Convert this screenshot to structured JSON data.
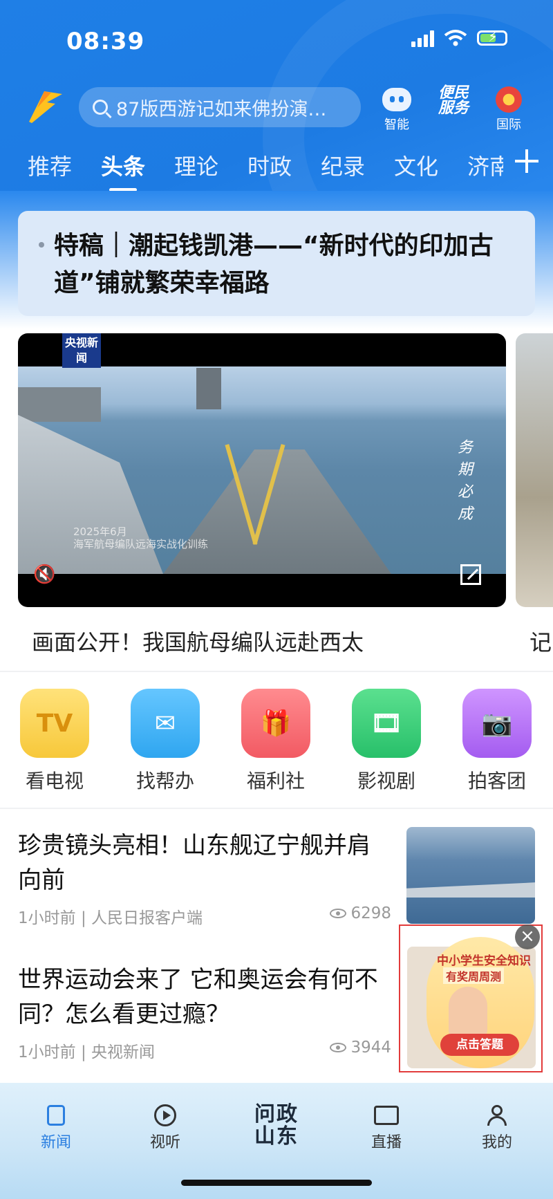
{
  "status_bar": {
    "time": "08:39"
  },
  "search": {
    "placeholder": "87版西游记如来佛扮演…"
  },
  "top_icons": [
    {
      "label": "智能",
      "icon": "robot-icon"
    },
    {
      "label": "便民服务",
      "icon": "service-icon"
    },
    {
      "label": "国际",
      "icon": "globe-flower-icon"
    }
  ],
  "tabs": [
    "推荐",
    "头条",
    "理论",
    "时政",
    "纪录",
    "文化",
    "济南"
  ],
  "active_tab": "头条",
  "headline": "特稿｜潮起钱凯港——“新时代的印加古道”铺就繁荣幸福路",
  "video": {
    "badge": "央视新闻",
    "overlay_text_1": "2025年6月",
    "overlay_text_2": "海军航母编队远海实战化训练",
    "side_text": "务期必成",
    "caption": "画面公开！我国航母编队远赴西太",
    "next_caption": "记"
  },
  "apps": [
    {
      "label": "看电视",
      "icon": "tv-icon",
      "color": "#f7c83a",
      "glyph": "TV"
    },
    {
      "label": "找帮办",
      "icon": "help-icon",
      "color": "#2fa6f0",
      "glyph": "✉"
    },
    {
      "label": "福利社",
      "icon": "gift-icon",
      "color": "#f25a63",
      "glyph": "🎁"
    },
    {
      "label": "影视剧",
      "icon": "film-icon",
      "color": "#28c06a",
      "glyph": "🎞"
    },
    {
      "label": "拍客团",
      "icon": "camera-icon",
      "color": "#a45cf0",
      "glyph": "📷"
    }
  ],
  "news": [
    {
      "title": "珍贵镜头亮相！山东舰辽宁舰并肩向前",
      "meta": "1小时前 | 人民日报客户端",
      "views": "6298"
    },
    {
      "title": "世界运动会来了 它和奥运会有何不同？怎么看更过瘾？",
      "meta": "1小时前 | 央视新闻",
      "views": "3944"
    }
  ],
  "ad": {
    "line1": "中小学生安全知识",
    "line2": "有奖周周测",
    "button": "点击答题",
    "close": "×"
  },
  "tabbar": [
    {
      "label": "新闻",
      "icon": "news-icon"
    },
    {
      "label": "视听",
      "icon": "play-icon"
    },
    {
      "label": "问政山东",
      "icon": "wenzheng-logo"
    },
    {
      "label": "直播",
      "icon": "live-camera-icon"
    },
    {
      "label": "我的",
      "icon": "profile-icon"
    }
  ],
  "colors": {
    "header_blue": "#1f7fe6",
    "active_tab_blue": "#2b7fe0",
    "ad_border": "#e23b3b"
  }
}
